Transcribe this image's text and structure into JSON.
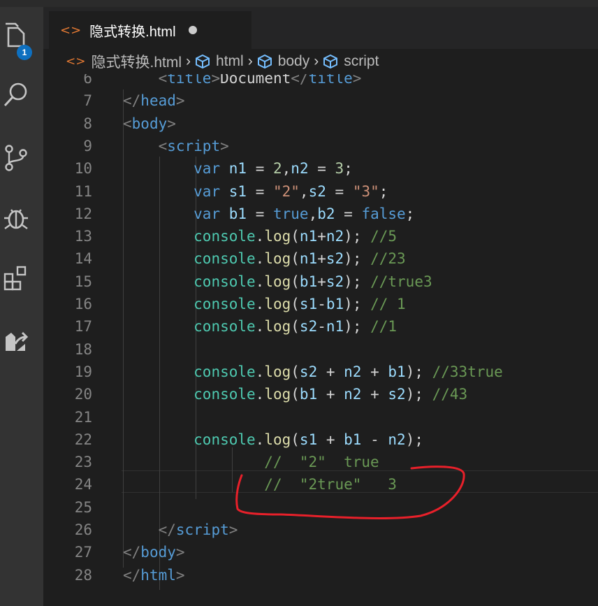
{
  "tab": {
    "title": "隐式转换.html"
  },
  "activity": {
    "badge_count": "1"
  },
  "breadcrumbs": {
    "file": "隐式转换.html",
    "items": [
      "html",
      "body",
      "script"
    ]
  },
  "editor": {
    "lines": [
      {
        "n": "6",
        "t": [
          [
            "pl",
            "    "
          ],
          [
            "t",
            "<"
          ],
          [
            "tag",
            "title"
          ],
          [
            "t",
            ">"
          ],
          [
            "pl",
            "Document"
          ],
          [
            "t",
            "</"
          ],
          [
            "tag",
            "title"
          ],
          [
            "t",
            ">"
          ]
        ]
      },
      {
        "n": "7",
        "t": [
          [
            "t",
            "</"
          ],
          [
            "tag",
            "head"
          ],
          [
            "t",
            ">"
          ]
        ]
      },
      {
        "n": "8",
        "t": [
          [
            "t",
            "<"
          ],
          [
            "tag",
            "body"
          ],
          [
            "t",
            ">"
          ]
        ]
      },
      {
        "n": "9",
        "t": [
          [
            "pl",
            "    "
          ],
          [
            "t",
            "<"
          ],
          [
            "tag",
            "script"
          ],
          [
            "t",
            ">"
          ]
        ]
      },
      {
        "n": "10",
        "t": [
          [
            "pl",
            "        "
          ],
          [
            "kw",
            "var"
          ],
          [
            "pl",
            " "
          ],
          [
            "var",
            "n1"
          ],
          [
            "pl",
            " = "
          ],
          [
            "num",
            "2"
          ],
          [
            "pl",
            ","
          ],
          [
            "var",
            "n2"
          ],
          [
            "pl",
            " = "
          ],
          [
            "num",
            "3"
          ],
          [
            "pl",
            ";"
          ]
        ]
      },
      {
        "n": "11",
        "t": [
          [
            "pl",
            "        "
          ],
          [
            "kw",
            "var"
          ],
          [
            "pl",
            " "
          ],
          [
            "var",
            "s1"
          ],
          [
            "pl",
            " = "
          ],
          [
            "str",
            "\"2\""
          ],
          [
            "pl",
            ","
          ],
          [
            "var",
            "s2"
          ],
          [
            "pl",
            " = "
          ],
          [
            "str",
            "\"3\""
          ],
          [
            "pl",
            ";"
          ]
        ]
      },
      {
        "n": "12",
        "t": [
          [
            "pl",
            "        "
          ],
          [
            "kw",
            "var"
          ],
          [
            "pl",
            " "
          ],
          [
            "var",
            "b1"
          ],
          [
            "pl",
            " = "
          ],
          [
            "kw",
            "true"
          ],
          [
            "pl",
            ","
          ],
          [
            "var",
            "b2"
          ],
          [
            "pl",
            " = "
          ],
          [
            "kw",
            "false"
          ],
          [
            "pl",
            ";"
          ]
        ]
      },
      {
        "n": "13",
        "t": [
          [
            "pl",
            "        "
          ],
          [
            "obj",
            "console"
          ],
          [
            "pl",
            "."
          ],
          [
            "fn",
            "log"
          ],
          [
            "pl",
            "("
          ],
          [
            "var",
            "n1"
          ],
          [
            "pl",
            "+"
          ],
          [
            "var",
            "n2"
          ],
          [
            "pl",
            "); "
          ],
          [
            "cm",
            "//5"
          ]
        ]
      },
      {
        "n": "14",
        "t": [
          [
            "pl",
            "        "
          ],
          [
            "obj",
            "console"
          ],
          [
            "pl",
            "."
          ],
          [
            "fn",
            "log"
          ],
          [
            "pl",
            "("
          ],
          [
            "var",
            "n1"
          ],
          [
            "pl",
            "+"
          ],
          [
            "var",
            "s2"
          ],
          [
            "pl",
            "); "
          ],
          [
            "cm",
            "//23"
          ]
        ]
      },
      {
        "n": "15",
        "t": [
          [
            "pl",
            "        "
          ],
          [
            "obj",
            "console"
          ],
          [
            "pl",
            "."
          ],
          [
            "fn",
            "log"
          ],
          [
            "pl",
            "("
          ],
          [
            "var",
            "b1"
          ],
          [
            "pl",
            "+"
          ],
          [
            "var",
            "s2"
          ],
          [
            "pl",
            "); "
          ],
          [
            "cm",
            "//true3"
          ]
        ]
      },
      {
        "n": "16",
        "t": [
          [
            "pl",
            "        "
          ],
          [
            "obj",
            "console"
          ],
          [
            "pl",
            "."
          ],
          [
            "fn",
            "log"
          ],
          [
            "pl",
            "("
          ],
          [
            "var",
            "s1"
          ],
          [
            "pl",
            "-"
          ],
          [
            "var",
            "b1"
          ],
          [
            "pl",
            "); "
          ],
          [
            "cm",
            "// 1"
          ]
        ]
      },
      {
        "n": "17",
        "t": [
          [
            "pl",
            "        "
          ],
          [
            "obj",
            "console"
          ],
          [
            "pl",
            "."
          ],
          [
            "fn",
            "log"
          ],
          [
            "pl",
            "("
          ],
          [
            "var",
            "s2"
          ],
          [
            "pl",
            "-"
          ],
          [
            "var",
            "n1"
          ],
          [
            "pl",
            "); "
          ],
          [
            "cm",
            "//1"
          ]
        ]
      },
      {
        "n": "18",
        "t": []
      },
      {
        "n": "19",
        "t": [
          [
            "pl",
            "        "
          ],
          [
            "obj",
            "console"
          ],
          [
            "pl",
            "."
          ],
          [
            "fn",
            "log"
          ],
          [
            "pl",
            "("
          ],
          [
            "var",
            "s2"
          ],
          [
            "pl",
            " + "
          ],
          [
            "var",
            "n2"
          ],
          [
            "pl",
            " + "
          ],
          [
            "var",
            "b1"
          ],
          [
            "pl",
            "); "
          ],
          [
            "cm",
            "//33true"
          ]
        ]
      },
      {
        "n": "20",
        "t": [
          [
            "pl",
            "        "
          ],
          [
            "obj",
            "console"
          ],
          [
            "pl",
            "."
          ],
          [
            "fn",
            "log"
          ],
          [
            "pl",
            "("
          ],
          [
            "var",
            "b1"
          ],
          [
            "pl",
            " + "
          ],
          [
            "var",
            "n2"
          ],
          [
            "pl",
            " + "
          ],
          [
            "var",
            "s2"
          ],
          [
            "pl",
            "); "
          ],
          [
            "cm",
            "//43"
          ]
        ]
      },
      {
        "n": "21",
        "t": []
      },
      {
        "n": "22",
        "t": [
          [
            "pl",
            "        "
          ],
          [
            "obj",
            "console"
          ],
          [
            "pl",
            "."
          ],
          [
            "fn",
            "log"
          ],
          [
            "pl",
            "("
          ],
          [
            "var",
            "s1"
          ],
          [
            "pl",
            " + "
          ],
          [
            "var",
            "b1"
          ],
          [
            "pl",
            " - "
          ],
          [
            "var",
            "n2"
          ],
          [
            "pl",
            ");"
          ]
        ]
      },
      {
        "n": "23",
        "t": [
          [
            "pl",
            "                "
          ],
          [
            "cm",
            "//  \"2\"  true"
          ]
        ]
      },
      {
        "n": "24",
        "t": [
          [
            "pl",
            "                "
          ],
          [
            "cm",
            "//  \"2true\"   3"
          ]
        ]
      },
      {
        "n": "25",
        "t": []
      },
      {
        "n": "26",
        "t": [
          [
            "pl",
            "    "
          ],
          [
            "t",
            "</"
          ],
          [
            "tag",
            "script"
          ],
          [
            "t",
            ">"
          ]
        ]
      },
      {
        "n": "27",
        "t": [
          [
            "t",
            "</"
          ],
          [
            "tag",
            "body"
          ],
          [
            "t",
            ">"
          ]
        ]
      },
      {
        "n": "28",
        "t": [
          [
            "t",
            "</"
          ],
          [
            "tag",
            "html"
          ],
          [
            "t",
            ">"
          ]
        ]
      }
    ]
  },
  "colors": {
    "accent_orange": "#e37933",
    "badge_blue": "#0e70c0",
    "annotation_red": "#e8202a"
  }
}
